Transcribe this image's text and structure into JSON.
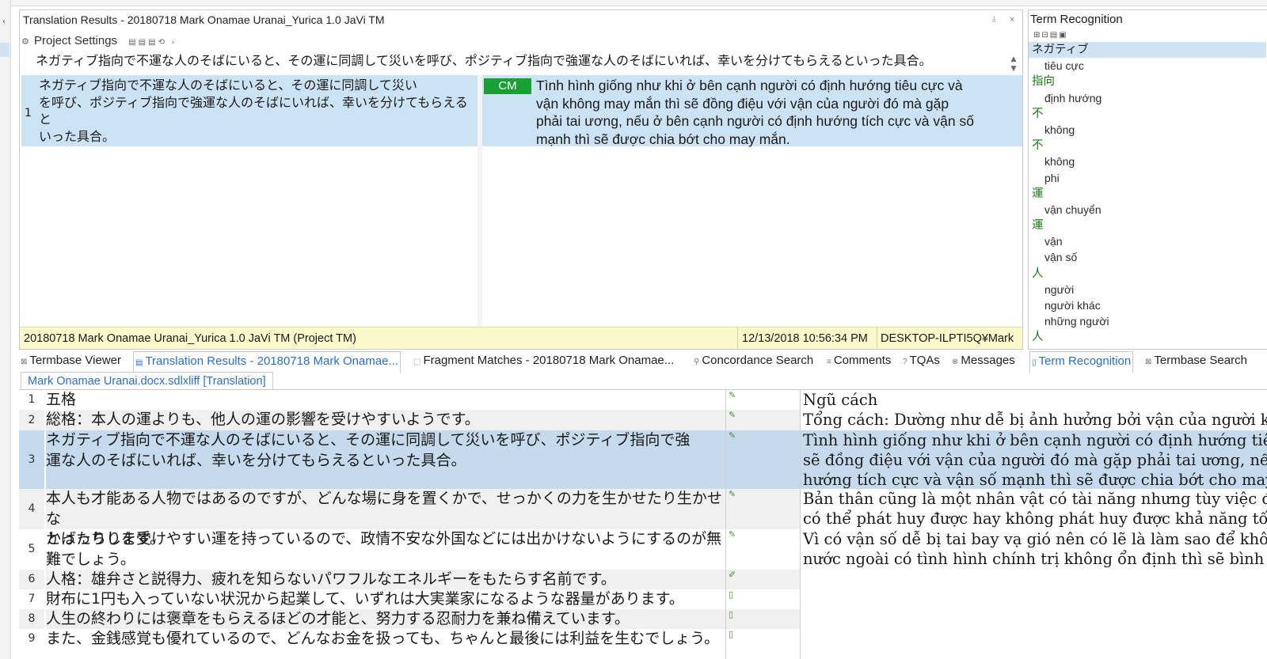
{
  "translation_results": {
    "title": "Translation Results - 20180718 Mark Onamae Uranai_Yurica 1.0 JaVi TM",
    "pin": "↕",
    "close": "×",
    "project_settings": "Project Settings",
    "source_line": "ネガティブ指向で不運な人のそばにいると、その運に同調して災いを呼び、ポジティブ指向で強運な人のそばにいれば、幸いを分けてもらえるといった具合。",
    "match": {
      "number": "1",
      "source_lines": [
        "ネガティブ指向で不運な人のそばにいると、その運に同調して災い",
        "を呼び、ポジティブ指向で強運な人のそばにいれば、幸いを分けてもらえると",
        "いった具合。"
      ],
      "badge": "CM",
      "target_lines": [
        "Tình hình giống như khi ở bên cạnh người có định hướng tiêu cực và",
        "vận không may mắn thì sẽ đồng điệu với vận của người đó mà gặp",
        "phải tai ương, nếu ở bên cạnh người có định hướng tích cực và vận số",
        "mạnh thì sẽ được chia bớt cho may mắn."
      ]
    },
    "status": {
      "tm_name": "20180718 Mark Onamae Uranai_Yurica 1.0 JaVi TM (Project TM)",
      "date": "12/13/2018 10:56:34 PM",
      "user": "DESKTOP-ILPTI5Q¥Mark"
    }
  },
  "term_recognition": {
    "title": "Term Recognition",
    "terms": [
      {
        "text": "ネガティブ",
        "kind": "src"
      },
      {
        "text": "tiêu cực",
        "kind": "tgt"
      },
      {
        "text": "指向",
        "kind": "src"
      },
      {
        "text": "định hướng",
        "kind": "tgt"
      },
      {
        "text": "不",
        "kind": "src"
      },
      {
        "text": "không",
        "kind": "tgt"
      },
      {
        "text": "不",
        "kind": "src"
      },
      {
        "text": "không",
        "kind": "tgt"
      },
      {
        "text": "phi",
        "kind": "tgt"
      },
      {
        "text": "運",
        "kind": "src"
      },
      {
        "text": "vận chuyển",
        "kind": "tgt"
      },
      {
        "text": "運",
        "kind": "src"
      },
      {
        "text": "vận",
        "kind": "tgt"
      },
      {
        "text": "vận số",
        "kind": "tgt"
      },
      {
        "text": "人",
        "kind": "src"
      },
      {
        "text": "người",
        "kind": "tgt"
      },
      {
        "text": "người khác",
        "kind": "tgt"
      },
      {
        "text": "những người",
        "kind": "tgt"
      },
      {
        "text": "人",
        "kind": "src"
      }
    ]
  },
  "tabs": {
    "termbase_viewer": "Termbase Viewer",
    "translation_results": "Translation Results - 20180718 Mark Onamae...",
    "fragment_matches": "Fragment Matches - 20180718 Mark Onamae...",
    "concordance": "Concordance Search",
    "comments": "Comments",
    "tqas": "TQAs",
    "messages": "Messages",
    "term_recognition": "Term Recognition",
    "termbase_search": "Termbase Search"
  },
  "editor": {
    "doc_tab": "Mark Onamae Uranai.docx.sdlxliff [Translation]",
    "rows": [
      {
        "num": "1",
        "src": [
          "五格"
        ],
        "tgt": [
          "Ngũ cách"
        ]
      },
      {
        "num": "2",
        "src": [
          "総格：本人の運よりも、他人の運の影響を受けやすいようです。"
        ],
        "tgt": [
          "Tổng cách: Dường như dễ bị ảnh hưởng bởi vận của người khác"
        ]
      },
      {
        "num": "3",
        "src": [
          "ネガティブ指向で不運な人のそばにいると、その運に同調して災いを呼び、ポジティブ指向で強",
          "運な人のそばにいれば、幸いを分けてもらえるといった具合。"
        ],
        "tgt": [
          "Tình hình giống như khi ở bên cạnh người có định hướng tiêu cực",
          "sẽ đồng điệu với vận của người đó mà gặp phải tai ương, nếu ở",
          "hướng tích cực và vận số mạnh thì sẽ được chia bớt cho may mắn"
        ]
      },
      {
        "num": "4",
        "src": [
          "本人も才能ある人物ではあるのですが、どんな場に身を置くかで、せっかくの力を生かせたり生かせな",
          "かったりします。"
        ],
        "tgt": [
          "Bản thân cũng là một nhân vật có tài năng nhưng tùy việc đặt bả",
          "có thể phát huy được hay không phát huy được khả năng tốn nh"
        ]
      },
      {
        "num": "5",
        "src": [
          "とばっちりを受けやすい運を持っているので、政情不安な外国などには出かけないようにするのが無",
          "難でしょう。"
        ],
        "tgt": [
          "Vì có vận số dễ bị tai bay vạ gió nên có lẽ là làm sao để không đ",
          "nước ngoài có tình hình chính trị không ổn định thì sẽ bình an vô"
        ]
      },
      {
        "num": "6",
        "src": [
          "人格：雄弁さと説得力、疲れを知らないパワフルなエネルギーをもたらす名前です。"
        ],
        "tgt": [
          ""
        ]
      },
      {
        "num": "7",
        "src": [
          "財布に1円も入っていない状況から起業して、いずれは大実業家になるような器量があります。"
        ],
        "tgt": [
          ""
        ]
      },
      {
        "num": "8",
        "src": [
          "人生の終わりには褒章をもらえるほどの才能と、努力する忍耐力を兼ね備えています。"
        ],
        "tgt": [
          ""
        ]
      },
      {
        "num": "9",
        "src": [
          "また、金銭感覚も優れているので、どんなお金を扱っても、ちゃんと最後には利益を生むでしょう。"
        ],
        "tgt": [
          ""
        ]
      }
    ]
  }
}
